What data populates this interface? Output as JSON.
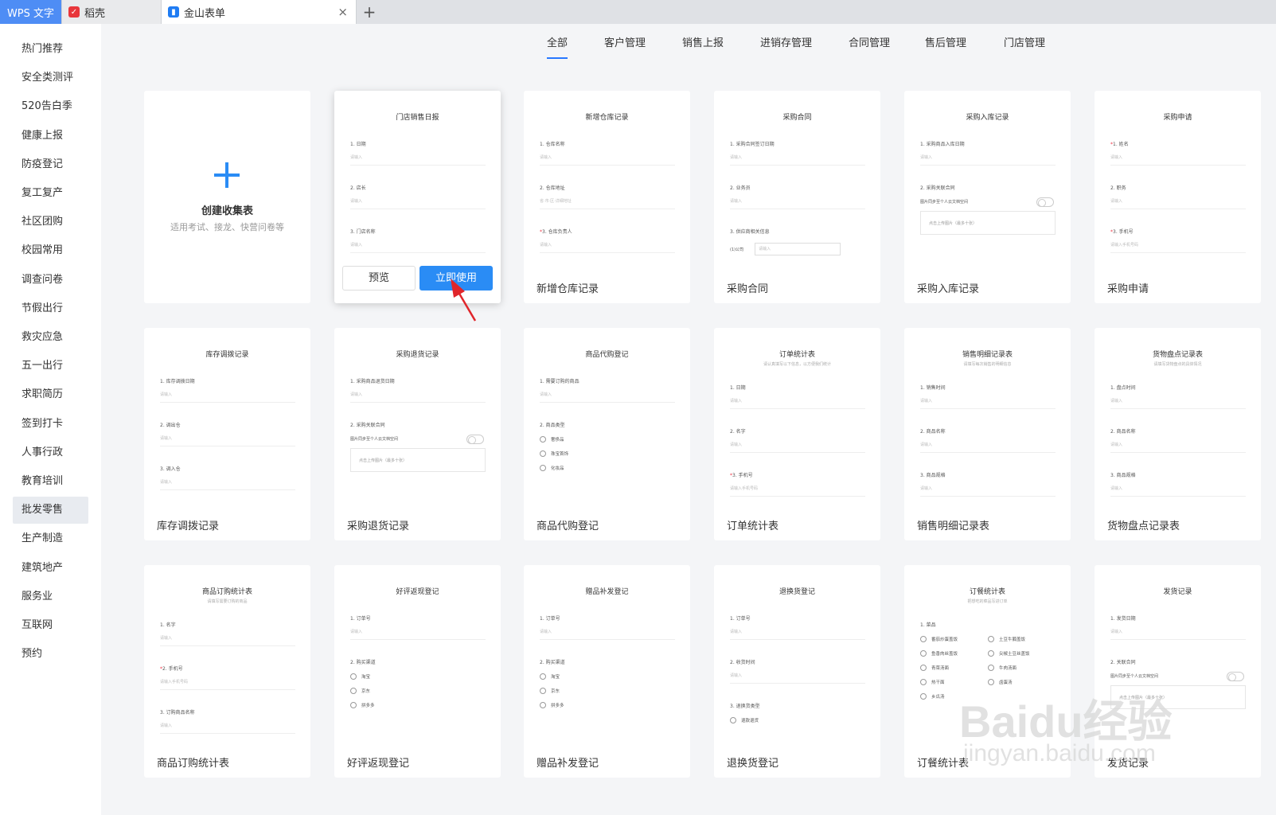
{
  "tabs": [
    {
      "label": "WPS 文字"
    },
    {
      "label": "稻壳"
    },
    {
      "label": "金山表单",
      "close": "×"
    }
  ],
  "new_tab": "+",
  "sidebar": [
    "热门推荐",
    "安全类测评",
    "520告白季",
    "健康上报",
    "防疫登记",
    "复工复产",
    "社区团购",
    "校园常用",
    "调查问卷",
    "节假出行",
    "救灾应急",
    "五一出行",
    "求职简历",
    "签到打卡",
    "人事行政",
    "教育培训",
    "批发零售",
    "生产制造",
    "建筑地产",
    "服务业",
    "互联网",
    "预约"
  ],
  "sidebar_selected": "批发零售",
  "categories": [
    "全部",
    "客户管理",
    "销售上报",
    "进销存管理",
    "合同管理",
    "售后管理",
    "门店管理"
  ],
  "category_selected": "全部",
  "create": {
    "title": "创建收集表",
    "subtitle": "适用考试、接龙、快营问卷等"
  },
  "buttons": {
    "preview": "预览",
    "use": "立即使用"
  },
  "templates": [
    {
      "title": "门店销售日报",
      "name": "",
      "q": [
        {
          "l": "1. 日期",
          "p": "请输入"
        },
        {
          "l": "2. 店长",
          "p": "请输入"
        },
        {
          "l": "3. 门店名称",
          "p": "请输入"
        }
      ]
    },
    {
      "title": "新增仓库记录",
      "name": "新增仓库记录",
      "q": [
        {
          "l": "1. 仓库名称",
          "p": "请输入"
        },
        {
          "l": "2. 仓库地址",
          "p": "省·市·区·详细地址"
        },
        {
          "l": "3. 仓库负责人",
          "p": "请输入",
          "req": true
        }
      ]
    },
    {
      "title": "采购合同",
      "name": "采购合同",
      "q": [
        {
          "l": "1. 采购合同签订日期",
          "p": "请输入"
        },
        {
          "l": "2. 业务员",
          "p": "请输入"
        },
        {
          "l": "3. 供应商相关信息",
          "mini": "(1)公司"
        }
      ]
    },
    {
      "title": "采购入库记录",
      "name": "采购入库记录",
      "q": [
        {
          "l": "1. 采购商品入库日期",
          "p": "请输入"
        },
        {
          "l": "2. 采购关联合同",
          "sync": "图片同步至个人云文档空间",
          "upload": "点击上传图片（最多十张）"
        }
      ]
    },
    {
      "title": "采购申请",
      "name": "采购申请",
      "q": [
        {
          "l": "1. 姓名",
          "p": "请输入",
          "req": true
        },
        {
          "l": "2. 职务",
          "p": "请输入"
        },
        {
          "l": "3. 手机号",
          "p": "请输入手机号码",
          "req": true
        }
      ]
    },
    {
      "title": "库存调拨记录",
      "name": "库存调拨记录",
      "q": [
        {
          "l": "1. 库存调拨日期",
          "p": "请输入"
        },
        {
          "l": "2. 调出仓",
          "p": "请输入"
        },
        {
          "l": "3. 调入仓",
          "p": "请输入"
        }
      ]
    },
    {
      "title": "采购退货记录",
      "name": "采购退货记录",
      "q": [
        {
          "l": "1. 采购商品退货日期",
          "p": "请输入"
        },
        {
          "l": "2. 采购关联合同",
          "sync": "图片同步至个人云文档空间",
          "upload": "点击上传图片（最多十张）"
        }
      ]
    },
    {
      "title": "商品代购登记",
      "name": "商品代购登记",
      "q": [
        {
          "l": "1. 需要订购的商品",
          "p": "请输入"
        },
        {
          "l": "2. 商品类型",
          "opts": [
            "奢侈品",
            "珠宝首饰",
            "化妆品"
          ]
        }
      ]
    },
    {
      "title": "订单统计表",
      "sub": "请认真填写以下信息，以方便我们统计",
      "name": "订单统计表",
      "q": [
        {
          "l": "1. 日期",
          "p": "请输入"
        },
        {
          "l": "2. 名字",
          "p": "请输入"
        },
        {
          "l": "3. 手机号",
          "p": "请输入手机号码",
          "req": true
        }
      ]
    },
    {
      "title": "销售明细记录表",
      "sub": "请填写每次销售的明细信息",
      "name": "销售明细记录表",
      "q": [
        {
          "l": "1. 销售时间",
          "p": "请输入"
        },
        {
          "l": "2. 商品名称",
          "p": "请输入"
        },
        {
          "l": "3. 商品规格",
          "p": "请输入"
        }
      ]
    },
    {
      "title": "货物盘点记录表",
      "sub": "请填写货物盘点的具体情况",
      "name": "货物盘点记录表",
      "q": [
        {
          "l": "1. 盘点时间",
          "p": "请输入"
        },
        {
          "l": "2. 商品名称",
          "p": "请输入"
        },
        {
          "l": "3. 商品规格",
          "p": "请输入"
        }
      ]
    },
    {
      "title": "商品订购统计表",
      "sub": "请填写需要订购的商品",
      "name": "商品订购统计表",
      "q": [
        {
          "l": "1. 名字",
          "p": "请输入"
        },
        {
          "l": "2. 手机号",
          "p": "请输入手机号码",
          "req": true
        },
        {
          "l": "3. 订购商品名称",
          "p": "请输入"
        }
      ]
    },
    {
      "title": "好评返现登记",
      "name": "好评返现登记",
      "q": [
        {
          "l": "1. 订单号",
          "p": "请输入"
        },
        {
          "l": "2. 购买渠道",
          "opts": [
            "淘宝",
            "京东",
            "拼多多"
          ]
        }
      ]
    },
    {
      "title": "赠品补发登记",
      "name": "赠品补发登记",
      "q": [
        {
          "l": "1. 订单号",
          "p": "请输入"
        },
        {
          "l": "2. 购买渠道",
          "opts": [
            "淘宝",
            "京东",
            "拼多多"
          ]
        }
      ]
    },
    {
      "title": "退换货登记",
      "name": "退换货登记",
      "q": [
        {
          "l": "1. 订单号",
          "p": "请输入"
        },
        {
          "l": "2. 收货时间",
          "p": "请输入"
        },
        {
          "l": "3. 退换货类型",
          "opts": [
            "退款退货"
          ]
        }
      ]
    },
    {
      "title": "订餐统计表",
      "sub": "把想吃的菜品写进订单",
      "name": "订餐统计表",
      "q": [
        {
          "l": "1. 菜品",
          "opts2": [
            "番茄炒蛋盖饭",
            "土豆牛腩盖饭",
            "鱼香肉丝盖饭",
            "尖椒土豆丝盖饭",
            "青菜汤面",
            "牛肉汤面",
            "热干面",
            "卤蛋汤",
            "乡瓜汤"
          ]
        }
      ]
    },
    {
      "title": "发货记录",
      "name": "发货记录",
      "q": [
        {
          "l": "1. 发货日期",
          "p": "请输入"
        },
        {
          "l": "2. 关联合同",
          "sync": "图片同步至个人云文档空间",
          "upload": "点击上传图片（最多十张）"
        }
      ]
    }
  ],
  "watermark": {
    "text": "Baidu经验",
    "url": "jingyan.baidu.com"
  },
  "colors": {
    "accent": "#2a8cf5",
    "sidebar_selected_bg": "#e8ebf0",
    "arrow": "#e0262b"
  }
}
